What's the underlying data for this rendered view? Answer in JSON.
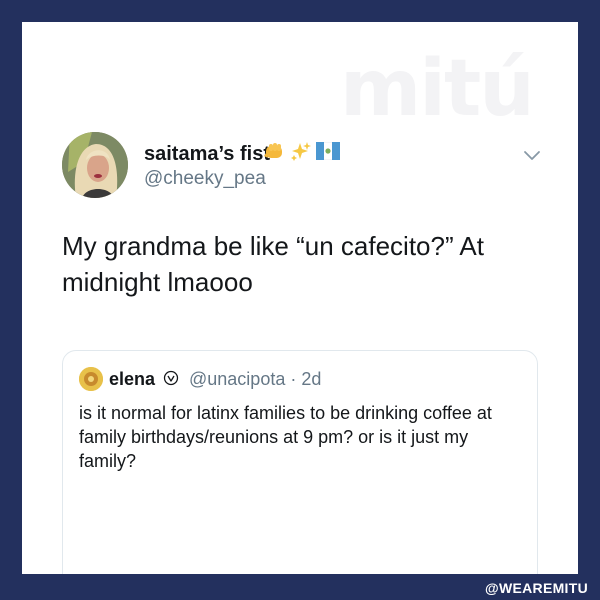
{
  "brand": {
    "watermark": "mitú",
    "footer_handle": "@WEAREMITU"
  },
  "tweet": {
    "display_name": "saitama’s fist",
    "handle": "@cheeky_pea",
    "emojis": [
      "fist-emoji",
      "sparkles-emoji",
      "guatemala-flag-emoji"
    ],
    "text": "My grandma be like “un cafecito?” At midnight lmaooo"
  },
  "quoted_tweet": {
    "display_name": "elena",
    "handle_meta": "@unacipota · 2d",
    "text": "is it normal for latinx families to be drinking coffee at family birthdays/reunions at 9 pm? or is it just my family?"
  },
  "colors": {
    "frame": "#23305e",
    "card": "#ffffff",
    "text": "#14171a",
    "muted": "#657786",
    "border": "#e1e8ed",
    "watermark": "#f3f3f5"
  }
}
